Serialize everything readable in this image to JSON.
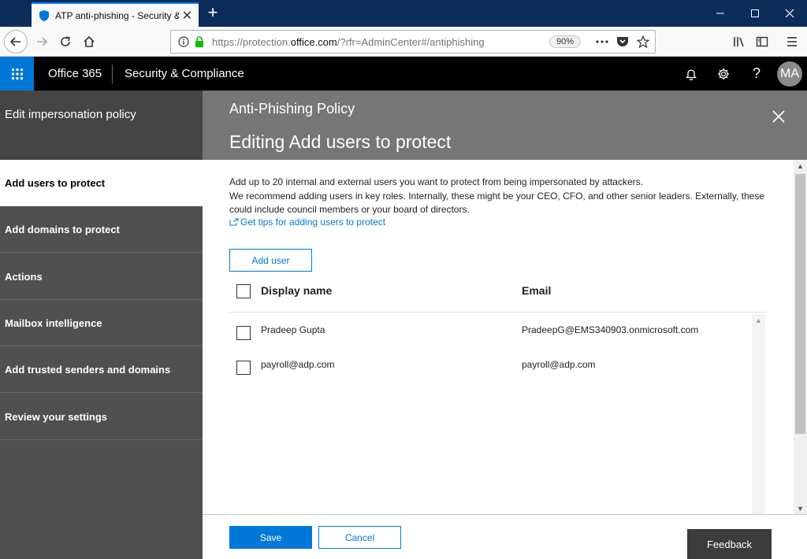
{
  "browser": {
    "tab_title": "ATP anti-phishing - Security &",
    "url_prefix": "https://protection.",
    "url_domain": "office.com",
    "url_suffix": "/?rfr=AdminCenter#/antiphishing",
    "zoom": "90%"
  },
  "o365": {
    "brand": "Office 365",
    "suite": "Security & Compliance",
    "avatar_initials": "MA"
  },
  "wizard": {
    "title": "Edit impersonation policy",
    "steps": [
      "Add users to protect",
      "Add domains to protect",
      "Actions",
      "Mailbox intelligence",
      "Add trusted senders and domains",
      "Review your settings"
    ],
    "active_step": 0
  },
  "panel": {
    "subtitle": "Anti-Phishing Policy",
    "title": "Editing Add users to protect"
  },
  "content": {
    "desc_line1": "Add up to 20 internal and external users you want to protect from being impersonated by attackers.",
    "desc_line2": "We recommend adding users in key roles. Internally, these might be your CEO, CFO, and other senior leaders. Externally, these could include council members or your board of directors.",
    "tips_link": "Get tips for adding users to protect",
    "add_user_label": "Add user",
    "columns": [
      "Display name",
      "Email"
    ],
    "rows": [
      {
        "name": "Pradeep Gupta",
        "email": "PradeepG@EMS340903.onmicrosoft.com"
      },
      {
        "name": "payroll@adp.com",
        "email": "payroll@adp.com"
      }
    ]
  },
  "footer": {
    "save_label": "Save",
    "cancel_label": "Cancel",
    "feedback_label": "Feedback"
  },
  "colors": {
    "accent": "#0078d7",
    "header_bg": "#000000",
    "left_panel": "#505050",
    "title_band": "#767676"
  },
  "icons": {
    "waffle": "app-launcher-icon",
    "notifications": "bell-icon",
    "settings": "gear-icon",
    "help": "help-icon"
  }
}
